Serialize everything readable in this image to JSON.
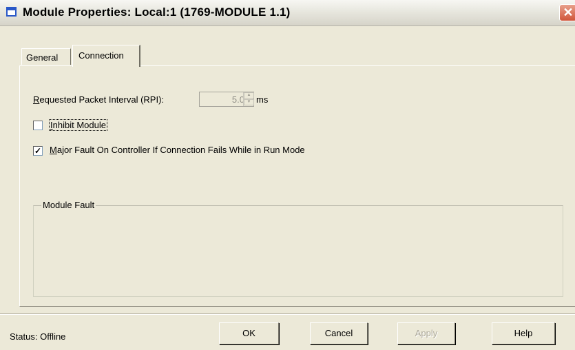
{
  "window": {
    "title": "Module Properties: Local:1 (1769-MODULE 1.1)",
    "close_glyph": "✕"
  },
  "tabs": [
    {
      "label": "General",
      "selected": false
    },
    {
      "label": "Connection",
      "selected": true
    }
  ],
  "connection": {
    "rpi_label_accel": "R",
    "rpi_label_rest": "equested Packet Interval (RPI):",
    "rpi_value": "5.0",
    "rpi_unit": "ms",
    "inhibit_module": {
      "accel": "I",
      "rest": "nhibit Module",
      "checked": false
    },
    "major_fault": {
      "accel": "M",
      "rest": "ajor Fault On Controller If Connection Fails While in Run Mode",
      "checked": true,
      "mark": "✓"
    },
    "module_fault_title": "Module Fault"
  },
  "footer": {
    "status": "Status:  Offline",
    "buttons": {
      "ok": "OK",
      "cancel": "Cancel",
      "apply": "Apply",
      "help": "Help"
    }
  }
}
